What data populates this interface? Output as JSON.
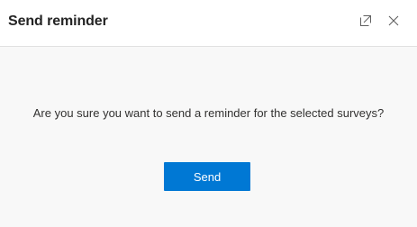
{
  "dialog": {
    "title": "Send reminder",
    "header_icons": {
      "popout": "popout-icon",
      "close": "close-icon"
    },
    "message": "Are you sure you want to send a reminder for the selected surveys?",
    "send_label": "Send"
  },
  "colors": {
    "accent": "#0078d4",
    "background": "#f8f8f8",
    "header": "#ffffff",
    "text": "#323130"
  }
}
